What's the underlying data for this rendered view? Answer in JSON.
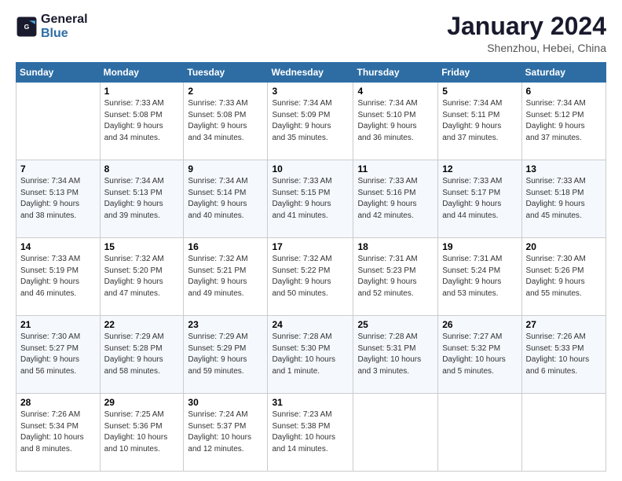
{
  "logo": {
    "line1": "General",
    "line2": "Blue"
  },
  "header": {
    "title": "January 2024",
    "subtitle": "Shenzhou, Hebei, China"
  },
  "days_of_week": [
    "Sunday",
    "Monday",
    "Tuesday",
    "Wednesday",
    "Thursday",
    "Friday",
    "Saturday"
  ],
  "weeks": [
    [
      {
        "day": "",
        "info": ""
      },
      {
        "day": "1",
        "info": "Sunrise: 7:33 AM\nSunset: 5:08 PM\nDaylight: 9 hours\nand 34 minutes."
      },
      {
        "day": "2",
        "info": "Sunrise: 7:33 AM\nSunset: 5:08 PM\nDaylight: 9 hours\nand 34 minutes."
      },
      {
        "day": "3",
        "info": "Sunrise: 7:34 AM\nSunset: 5:09 PM\nDaylight: 9 hours\nand 35 minutes."
      },
      {
        "day": "4",
        "info": "Sunrise: 7:34 AM\nSunset: 5:10 PM\nDaylight: 9 hours\nand 36 minutes."
      },
      {
        "day": "5",
        "info": "Sunrise: 7:34 AM\nSunset: 5:11 PM\nDaylight: 9 hours\nand 37 minutes."
      },
      {
        "day": "6",
        "info": "Sunrise: 7:34 AM\nSunset: 5:12 PM\nDaylight: 9 hours\nand 37 minutes."
      }
    ],
    [
      {
        "day": "7",
        "info": "Sunrise: 7:34 AM\nSunset: 5:13 PM\nDaylight: 9 hours\nand 38 minutes."
      },
      {
        "day": "8",
        "info": "Sunrise: 7:34 AM\nSunset: 5:13 PM\nDaylight: 9 hours\nand 39 minutes."
      },
      {
        "day": "9",
        "info": "Sunrise: 7:34 AM\nSunset: 5:14 PM\nDaylight: 9 hours\nand 40 minutes."
      },
      {
        "day": "10",
        "info": "Sunrise: 7:33 AM\nSunset: 5:15 PM\nDaylight: 9 hours\nand 41 minutes."
      },
      {
        "day": "11",
        "info": "Sunrise: 7:33 AM\nSunset: 5:16 PM\nDaylight: 9 hours\nand 42 minutes."
      },
      {
        "day": "12",
        "info": "Sunrise: 7:33 AM\nSunset: 5:17 PM\nDaylight: 9 hours\nand 44 minutes."
      },
      {
        "day": "13",
        "info": "Sunrise: 7:33 AM\nSunset: 5:18 PM\nDaylight: 9 hours\nand 45 minutes."
      }
    ],
    [
      {
        "day": "14",
        "info": "Sunrise: 7:33 AM\nSunset: 5:19 PM\nDaylight: 9 hours\nand 46 minutes."
      },
      {
        "day": "15",
        "info": "Sunrise: 7:32 AM\nSunset: 5:20 PM\nDaylight: 9 hours\nand 47 minutes."
      },
      {
        "day": "16",
        "info": "Sunrise: 7:32 AM\nSunset: 5:21 PM\nDaylight: 9 hours\nand 49 minutes."
      },
      {
        "day": "17",
        "info": "Sunrise: 7:32 AM\nSunset: 5:22 PM\nDaylight: 9 hours\nand 50 minutes."
      },
      {
        "day": "18",
        "info": "Sunrise: 7:31 AM\nSunset: 5:23 PM\nDaylight: 9 hours\nand 52 minutes."
      },
      {
        "day": "19",
        "info": "Sunrise: 7:31 AM\nSunset: 5:24 PM\nDaylight: 9 hours\nand 53 minutes."
      },
      {
        "day": "20",
        "info": "Sunrise: 7:30 AM\nSunset: 5:26 PM\nDaylight: 9 hours\nand 55 minutes."
      }
    ],
    [
      {
        "day": "21",
        "info": "Sunrise: 7:30 AM\nSunset: 5:27 PM\nDaylight: 9 hours\nand 56 minutes."
      },
      {
        "day": "22",
        "info": "Sunrise: 7:29 AM\nSunset: 5:28 PM\nDaylight: 9 hours\nand 58 minutes."
      },
      {
        "day": "23",
        "info": "Sunrise: 7:29 AM\nSunset: 5:29 PM\nDaylight: 9 hours\nand 59 minutes."
      },
      {
        "day": "24",
        "info": "Sunrise: 7:28 AM\nSunset: 5:30 PM\nDaylight: 10 hours\nand 1 minute."
      },
      {
        "day": "25",
        "info": "Sunrise: 7:28 AM\nSunset: 5:31 PM\nDaylight: 10 hours\nand 3 minutes."
      },
      {
        "day": "26",
        "info": "Sunrise: 7:27 AM\nSunset: 5:32 PM\nDaylight: 10 hours\nand 5 minutes."
      },
      {
        "day": "27",
        "info": "Sunrise: 7:26 AM\nSunset: 5:33 PM\nDaylight: 10 hours\nand 6 minutes."
      }
    ],
    [
      {
        "day": "28",
        "info": "Sunrise: 7:26 AM\nSunset: 5:34 PM\nDaylight: 10 hours\nand 8 minutes."
      },
      {
        "day": "29",
        "info": "Sunrise: 7:25 AM\nSunset: 5:36 PM\nDaylight: 10 hours\nand 10 minutes."
      },
      {
        "day": "30",
        "info": "Sunrise: 7:24 AM\nSunset: 5:37 PM\nDaylight: 10 hours\nand 12 minutes."
      },
      {
        "day": "31",
        "info": "Sunrise: 7:23 AM\nSunset: 5:38 PM\nDaylight: 10 hours\nand 14 minutes."
      },
      {
        "day": "",
        "info": ""
      },
      {
        "day": "",
        "info": ""
      },
      {
        "day": "",
        "info": ""
      }
    ]
  ]
}
